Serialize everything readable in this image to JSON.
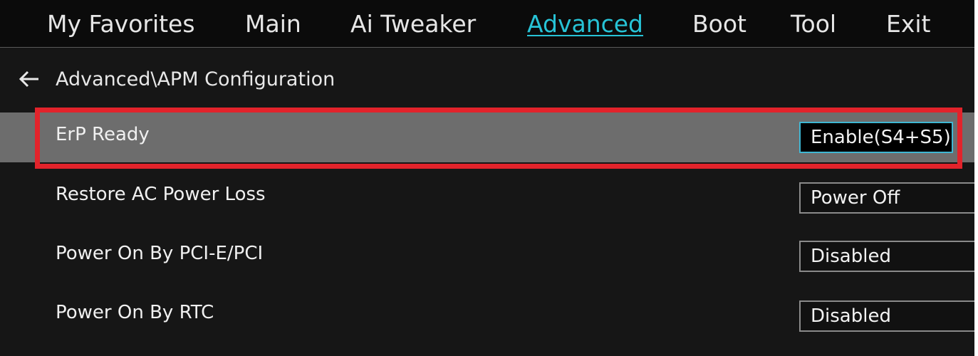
{
  "nav": {
    "tabs": [
      {
        "label": "My Favorites"
      },
      {
        "label": "Main"
      },
      {
        "label": "Ai Tweaker"
      },
      {
        "label": "Advanced",
        "active": true
      },
      {
        "label": "Boot"
      },
      {
        "label": "Tool"
      },
      {
        "label": "Exit"
      }
    ]
  },
  "breadcrumb": {
    "icon": "back-arrow-icon",
    "path": "Advanced\\APM Configuration"
  },
  "settings": [
    {
      "label": "ErP Ready",
      "value": "Enable(S4+S5)",
      "selected": true
    },
    {
      "label": "Restore AC Power Loss",
      "value": "Power Off"
    },
    {
      "label": "Power On By PCI-E/PCI",
      "value": "Disabled"
    },
    {
      "label": "Power On By RTC",
      "value": "Disabled"
    }
  ],
  "colors": {
    "accent": "#27c3d6",
    "highlight": "#e2232b",
    "selected_row": "#6d6d6d"
  }
}
